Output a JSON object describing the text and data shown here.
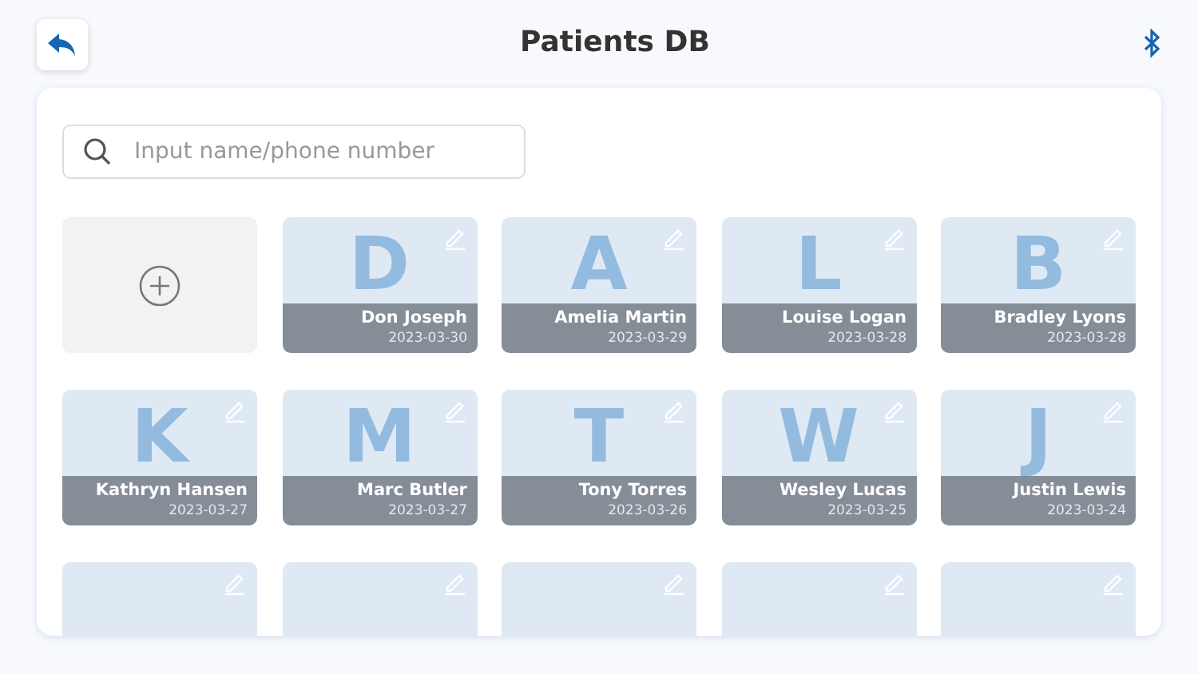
{
  "header": {
    "title": "Patients DB"
  },
  "search": {
    "placeholder": "Input name/phone number"
  },
  "patients": [
    {
      "kind": "full",
      "letter": "D",
      "name": "Don Joseph",
      "date": "2023-03-30"
    },
    {
      "kind": "full",
      "letter": "A",
      "name": "Amelia Martin",
      "date": "2023-03-29"
    },
    {
      "kind": "full",
      "letter": "L",
      "name": "Louise Logan",
      "date": "2023-03-28"
    },
    {
      "kind": "full",
      "letter": "B",
      "name": "Bradley Lyons",
      "date": "2023-03-28"
    },
    {
      "kind": "full",
      "letter": "K",
      "name": "Kathryn Hansen",
      "date": "2023-03-27"
    },
    {
      "kind": "full",
      "letter": "M",
      "name": "Marc Butler",
      "date": "2023-03-27"
    },
    {
      "kind": "full",
      "letter": "T",
      "name": "Tony Torres",
      "date": "2023-03-26"
    },
    {
      "kind": "full",
      "letter": "W",
      "name": "Wesley Lucas",
      "date": "2023-03-25"
    },
    {
      "kind": "full",
      "letter": "J",
      "name": "Justin Lewis",
      "date": "2023-03-24"
    },
    {
      "kind": "cut"
    },
    {
      "kind": "cut"
    },
    {
      "kind": "cut"
    },
    {
      "kind": "cut"
    },
    {
      "kind": "cut"
    }
  ]
}
